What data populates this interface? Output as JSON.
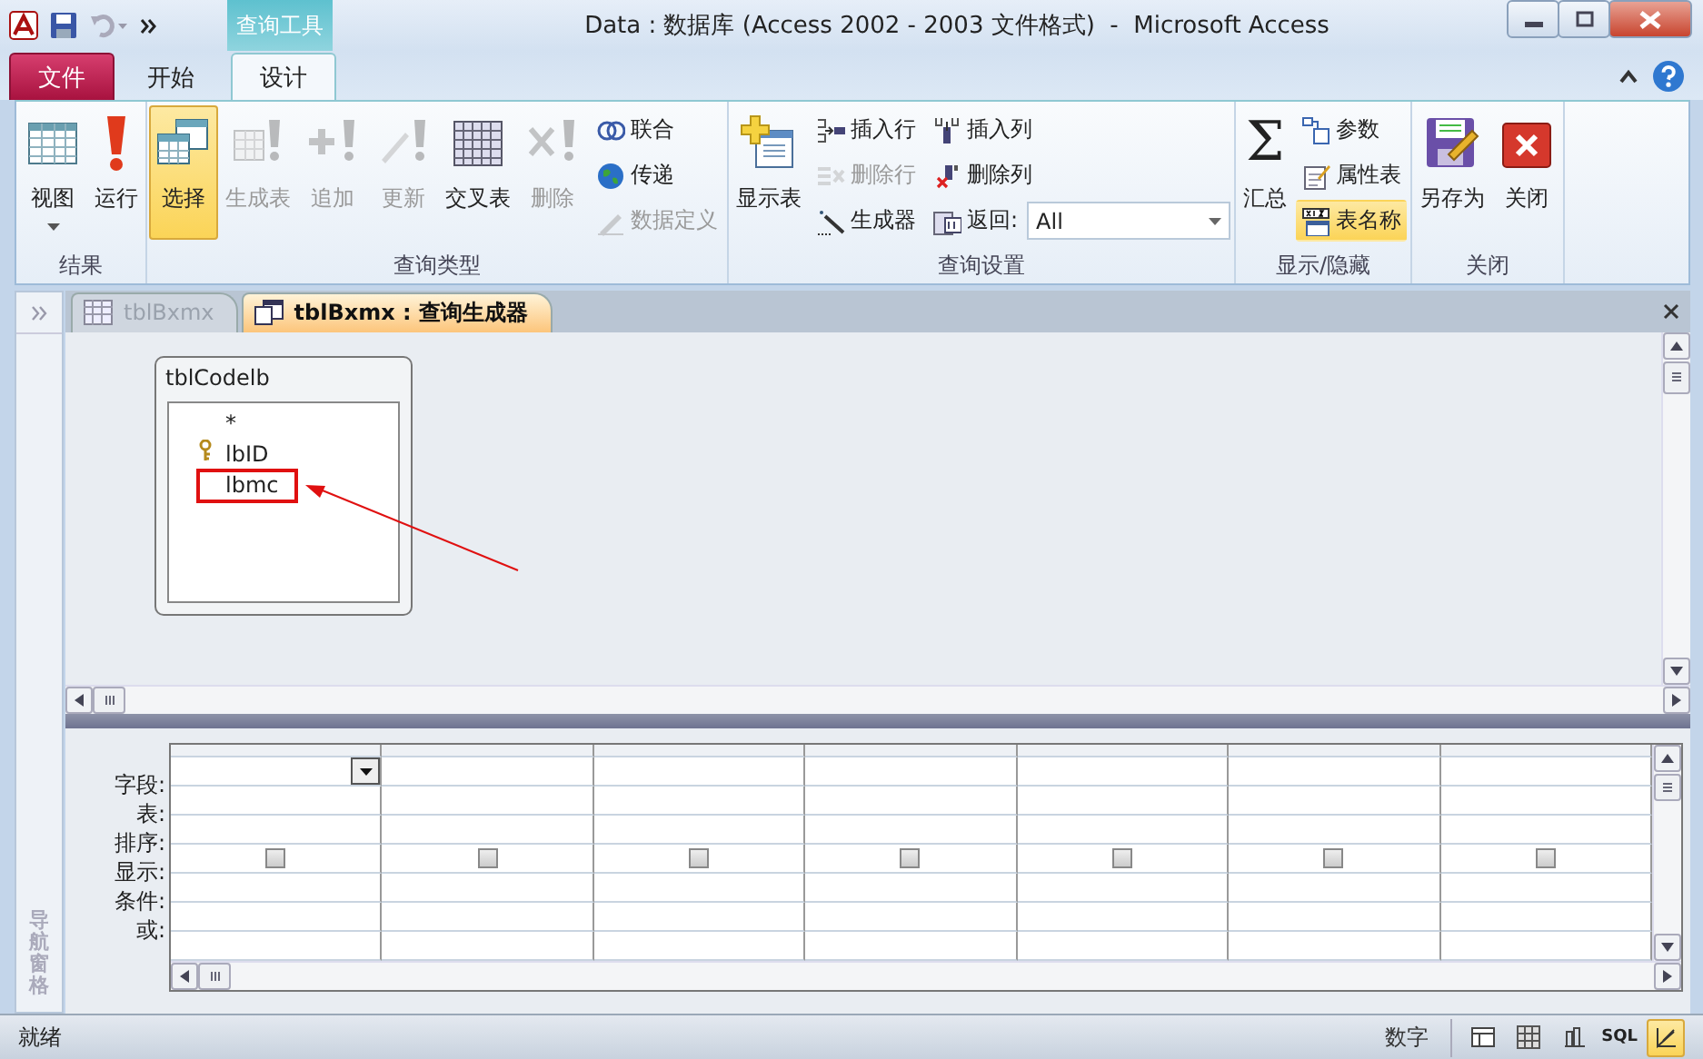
{
  "window": {
    "title": "Data : 数据库 (Access 2002 - 2003 文件格式)  -  Microsoft Access",
    "context_tab": "查询工具"
  },
  "ribbon_tabs": [
    {
      "label": "文件",
      "kind": "file",
      "selected": false
    },
    {
      "label": "开始",
      "kind": "normal",
      "selected": false
    },
    {
      "label": "设计",
      "kind": "normal",
      "selected": true
    }
  ],
  "ribbon_groups": [
    {
      "title": "结果",
      "items": [
        {
          "label": "视图",
          "kind": "large",
          "disabled": false,
          "selected": false,
          "dropdown": true
        },
        {
          "label": "运行",
          "kind": "large",
          "disabled": false,
          "selected": false
        }
      ]
    },
    {
      "title": "查询类型",
      "items": [
        {
          "label": "选择",
          "kind": "large",
          "disabled": false,
          "selected": true
        },
        {
          "label": "生成表",
          "kind": "large",
          "disabled": true,
          "selected": false
        },
        {
          "label": "追加",
          "kind": "large",
          "disabled": true,
          "selected": false
        },
        {
          "label": "更新",
          "kind": "large",
          "disabled": true,
          "selected": false
        },
        {
          "label": "交叉表",
          "kind": "large",
          "disabled": false,
          "selected": false
        },
        {
          "label": "删除",
          "kind": "large",
          "disabled": true,
          "selected": false
        },
        {
          "label": "联合",
          "kind": "small",
          "disabled": false,
          "selected": false
        },
        {
          "label": "传递",
          "kind": "small",
          "disabled": false,
          "selected": false
        },
        {
          "label": "数据定义",
          "kind": "small",
          "disabled": true,
          "selected": false
        }
      ]
    },
    {
      "title": "查询设置",
      "items": [
        {
          "label": "显示表",
          "kind": "large",
          "disabled": false,
          "selected": false
        },
        {
          "label": "插入行",
          "kind": "small",
          "disabled": false,
          "selected": false
        },
        {
          "label": "删除行",
          "kind": "small",
          "disabled": true,
          "selected": false
        },
        {
          "label": "生成器",
          "kind": "small",
          "disabled": false,
          "selected": false
        },
        {
          "label": "插入列",
          "kind": "small",
          "disabled": false,
          "selected": false
        },
        {
          "label": "删除列",
          "kind": "small",
          "disabled": false,
          "selected": false
        },
        {
          "label": "返回:",
          "kind": "combo",
          "value": "All",
          "disabled": false,
          "selected": false
        }
      ]
    },
    {
      "title": "显示/隐藏",
      "items": [
        {
          "label": "汇总",
          "kind": "large",
          "glyph": "Σ",
          "disabled": false,
          "selected": false
        },
        {
          "label": "参数",
          "kind": "small",
          "disabled": false,
          "selected": false
        },
        {
          "label": "属性表",
          "kind": "small",
          "disabled": false,
          "selected": false
        },
        {
          "label": "表名称",
          "kind": "small",
          "disabled": false,
          "selected": true
        }
      ]
    },
    {
      "title": "关闭",
      "items": [
        {
          "label": "另存为",
          "kind": "large",
          "disabled": false,
          "selected": false
        },
        {
          "label": "关闭",
          "kind": "large",
          "disabled": false,
          "selected": false
        }
      ]
    }
  ],
  "nav_pane": {
    "label": "导航窗格"
  },
  "document_tabs": [
    {
      "label": "tblBxmx",
      "selected": false
    },
    {
      "label": "tblBxmx : 查询生成器",
      "selected": true
    }
  ],
  "field_list": {
    "title": "tblCodelb",
    "fields": [
      {
        "label": "*",
        "key": false,
        "highlighted": false
      },
      {
        "label": "lbID",
        "key": true,
        "highlighted": false
      },
      {
        "label": "lbmc",
        "key": false,
        "highlighted": true
      }
    ]
  },
  "query_grid": {
    "row_labels": [
      "字段:",
      "表:",
      "排序:",
      "显示:",
      "条件:",
      "或:"
    ],
    "columns": [
      {
        "show": false,
        "selected": true
      },
      {
        "show": false,
        "selected": false
      },
      {
        "show": false,
        "selected": false
      },
      {
        "show": false,
        "selected": false
      },
      {
        "show": false,
        "selected": false
      },
      {
        "show": false,
        "selected": false
      },
      {
        "show": false,
        "selected": false
      }
    ]
  },
  "status_bar": {
    "text": "就绪",
    "mode": "数字",
    "views": [
      {
        "kind": "icon",
        "selected": false
      },
      {
        "kind": "icon",
        "selected": false
      },
      {
        "kind": "icon",
        "selected": false
      },
      {
        "kind": "text",
        "label": "SQL",
        "selected": false
      },
      {
        "kind": "icon",
        "selected": true
      }
    ]
  }
}
